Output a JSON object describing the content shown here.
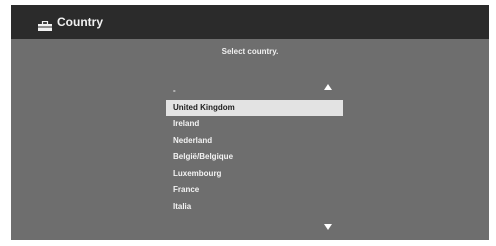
{
  "header": {
    "title": "Country",
    "icon": "suitcase-icon"
  },
  "prompt": "Select country.",
  "scroll": {
    "up_icon": "triangle-up-icon",
    "down_icon": "triangle-down-icon"
  },
  "countries": [
    {
      "label": "-",
      "selected": false
    },
    {
      "label": "United Kingdom",
      "selected": true
    },
    {
      "label": "Ireland",
      "selected": false
    },
    {
      "label": "Nederland",
      "selected": false
    },
    {
      "label": "België/Belgique",
      "selected": false
    },
    {
      "label": "Luxembourg",
      "selected": false
    },
    {
      "label": "France",
      "selected": false
    },
    {
      "label": "Italia",
      "selected": false
    }
  ],
  "colors": {
    "screen_bg": "#6e6e6e",
    "header_bg": "#2b2b2b",
    "selection_bg": "#e3e3e3"
  }
}
